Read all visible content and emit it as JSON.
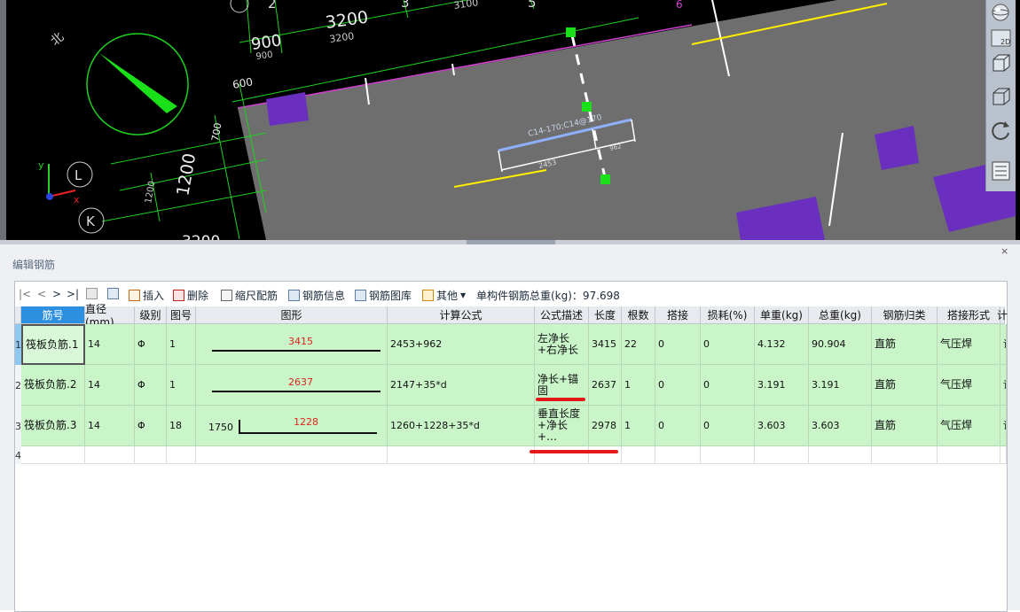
{
  "cad": {
    "compass_label": "北",
    "axis_labels": [
      "L",
      "K"
    ],
    "top_axis_numbers": [
      "2",
      "3",
      "5",
      "6"
    ],
    "dim_texts": [
      "3200",
      "3200",
      "3100",
      "900",
      "900",
      "600",
      "700",
      "1200",
      "1200",
      "3200"
    ],
    "rebar_label": "C14-170;C14@170",
    "rebar_dims": [
      "2453",
      "962"
    ],
    "toolbar_icons": [
      "view-sphere-icon",
      "view-2d-icon",
      "view-3d-box-icon",
      "view-solid-icon",
      "rotate-icon",
      "layer-icon"
    ],
    "view_2d_label": "2D",
    "colors": {
      "background": "#000000",
      "slab": "#6e6e6e",
      "column": "#6a2fbf",
      "axis_green": "#1fd11f",
      "rebar_blue": "#8fb0ff",
      "yellow": "#ffee00"
    }
  },
  "panel": {
    "title": "编辑钢筋",
    "close": "×"
  },
  "toolbar": {
    "nav": [
      "|<",
      "<",
      ">",
      ">|"
    ],
    "insert": "插入",
    "delete": "删除",
    "scale": "缩尺配筋",
    "rebar_info": "钢筋信息",
    "rebar_library": "钢筋图库",
    "other": "其他",
    "total_weight": "单构件钢筋总重(kg)：97.698"
  },
  "table": {
    "headers": [
      "筋号",
      "直径(mm)",
      "级别",
      "图号",
      "图形",
      "计算公式",
      "公式描述",
      "长度",
      "根数",
      "搭接",
      "损耗(%)",
      "单重(kg)",
      "总重(kg)",
      "钢筋归类",
      "搭接形式",
      "计"
    ],
    "rows": [
      {
        "num": "1",
        "name": "筏板负筋.1",
        "dia": "14",
        "grade": "Φ",
        "fig": "1",
        "shape_left": "",
        "shape_val": "3415",
        "formula": "2453+962",
        "desc": "左净长+右净长",
        "length": "3415",
        "count": "22",
        "lap": "0",
        "loss": "0",
        "unit_w": "4.132",
        "total_w": "90.904",
        "category": "直筋",
        "lap_type": "气压焊",
        "extra": "请"
      },
      {
        "num": "2",
        "name": "筏板负筋.2",
        "dia": "14",
        "grade": "Φ",
        "fig": "1",
        "shape_left": "",
        "shape_val": "2637",
        "formula": "2147+35*d",
        "desc": "净长+锚固",
        "length": "2637",
        "count": "1",
        "lap": "0",
        "loss": "0",
        "unit_w": "3.191",
        "total_w": "3.191",
        "category": "直筋",
        "lap_type": "气压焊",
        "extra": "请"
      },
      {
        "num": "3",
        "name": "筏板负筋.3",
        "dia": "14",
        "grade": "Φ",
        "fig": "18",
        "shape_left": "1750",
        "shape_val": "1228",
        "formula": "1260+1228+35*d",
        "desc": "垂直长度+净长+…",
        "length": "2978",
        "count": "1",
        "lap": "0",
        "loss": "0",
        "unit_w": "3.603",
        "total_w": "3.603",
        "category": "直筋",
        "lap_type": "气压焊",
        "extra": "请"
      }
    ],
    "empty_row_num": "4"
  }
}
